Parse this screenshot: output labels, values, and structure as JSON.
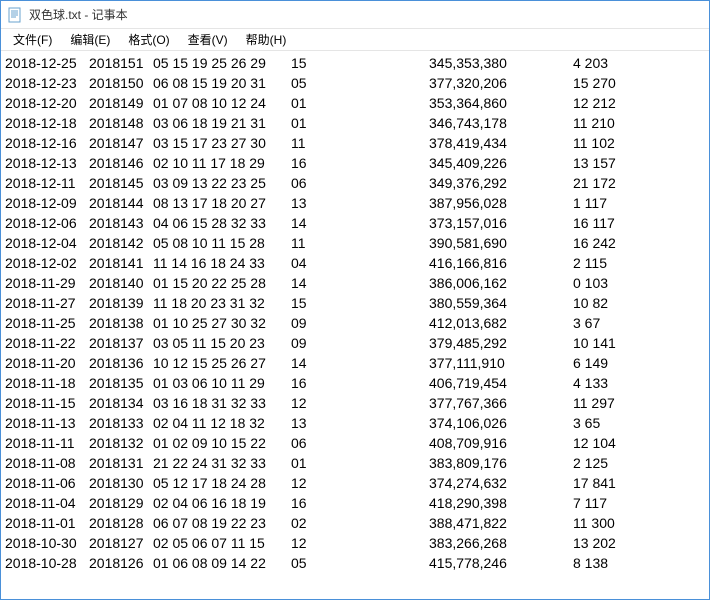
{
  "window": {
    "title": "双色球.txt - 记事本"
  },
  "menu": {
    "file": "文件(F)",
    "edit": "编辑(E)",
    "format": "格式(O)",
    "view": "查看(V)",
    "help": "帮助(H)"
  },
  "rows": [
    {
      "date": "2018-12-25",
      "issue": "2018151",
      "balls": "05 15 19 25 26 29",
      "blue": "15",
      "sales": "345,353,380",
      "prize": "4 203"
    },
    {
      "date": "2018-12-23",
      "issue": "2018150",
      "balls": "06 08 15 19 20 31",
      "blue": "05",
      "sales": "377,320,206",
      "prize": "15 270"
    },
    {
      "date": "2018-12-20",
      "issue": "2018149",
      "balls": "01 07 08 10 12 24",
      "blue": "01",
      "sales": "353,364,860",
      "prize": "12 212"
    },
    {
      "date": "2018-12-18",
      "issue": "2018148",
      "balls": "03 06 18 19 21 31",
      "blue": "01",
      "sales": "346,743,178",
      "prize": "11 210"
    },
    {
      "date": "2018-12-16",
      "issue": "2018147",
      "balls": "03 15 17 23 27 30",
      "blue": "11",
      "sales": "378,419,434",
      "prize": "11 102"
    },
    {
      "date": "2018-12-13",
      "issue": "2018146",
      "balls": "02 10 11 17 18 29",
      "blue": "16",
      "sales": "345,409,226",
      "prize": "13 157"
    },
    {
      "date": "2018-12-11",
      "issue": "2018145",
      "balls": "03 09 13 22 23 25",
      "blue": "06",
      "sales": "349,376,292",
      "prize": "21 172"
    },
    {
      "date": "2018-12-09",
      "issue": "2018144",
      "balls": "08 13 17 18 20 27",
      "blue": "13",
      "sales": "387,956,028",
      "prize": "1 117"
    },
    {
      "date": "2018-12-06",
      "issue": "2018143",
      "balls": "04 06 15 28 32 33",
      "blue": "14",
      "sales": "373,157,016",
      "prize": "16 117"
    },
    {
      "date": "2018-12-04",
      "issue": "2018142",
      "balls": "05 08 10 11 15 28",
      "blue": "11",
      "sales": "390,581,690",
      "prize": "16 242"
    },
    {
      "date": "2018-12-02",
      "issue": "2018141",
      "balls": "11 14 16 18 24 33",
      "blue": "04",
      "sales": "416,166,816",
      "prize": "2 115"
    },
    {
      "date": "2018-11-29",
      "issue": "2018140",
      "balls": "01 15 20 22 25 28",
      "blue": "14",
      "sales": "386,006,162",
      "prize": "0 103"
    },
    {
      "date": "2018-11-27",
      "issue": "2018139",
      "balls": "11 18 20 23 31 32",
      "blue": "15",
      "sales": "380,559,364",
      "prize": "10 82"
    },
    {
      "date": "2018-11-25",
      "issue": "2018138",
      "balls": "01 10 25 27 30 32",
      "blue": "09",
      "sales": "412,013,682",
      "prize": "3 67"
    },
    {
      "date": "2018-11-22",
      "issue": "2018137",
      "balls": "03 05 11 15 20 23",
      "blue": "09",
      "sales": "379,485,292",
      "prize": "10 141"
    },
    {
      "date": "2018-11-20",
      "issue": "2018136",
      "balls": "10 12 15 25 26 27",
      "blue": "14",
      "sales": "377,111,910",
      "prize": "6 149"
    },
    {
      "date": "2018-11-18",
      "issue": "2018135",
      "balls": "01 03 06 10 11 29",
      "blue": "16",
      "sales": "406,719,454",
      "prize": "4 133"
    },
    {
      "date": "2018-11-15",
      "issue": "2018134",
      "balls": "03 16 18 31 32 33",
      "blue": "12",
      "sales": "377,767,366",
      "prize": "11 297"
    },
    {
      "date": "2018-11-13",
      "issue": "2018133",
      "balls": "02 04 11 12 18 32",
      "blue": "13",
      "sales": "374,106,026",
      "prize": "3 65"
    },
    {
      "date": "2018-11-11",
      "issue": "2018132",
      "balls": "01 02 09 10 15 22",
      "blue": "06",
      "sales": "408,709,916",
      "prize": "12 104"
    },
    {
      "date": "2018-11-08",
      "issue": "2018131",
      "balls": "21 22 24 31 32 33",
      "blue": "01",
      "sales": "383,809,176",
      "prize": "2 125"
    },
    {
      "date": "2018-11-06",
      "issue": "2018130",
      "balls": "05 12 17 18 24 28",
      "blue": "12",
      "sales": "374,274,632",
      "prize": "17 841"
    },
    {
      "date": "2018-11-04",
      "issue": "2018129",
      "balls": "02 04 06 16 18 19",
      "blue": "16",
      "sales": "418,290,398",
      "prize": "7 117"
    },
    {
      "date": "2018-11-01",
      "issue": "2018128",
      "balls": "06 07 08 19 22 23",
      "blue": "02",
      "sales": "388,471,822",
      "prize": "11 300"
    },
    {
      "date": "2018-10-30",
      "issue": "2018127",
      "balls": "02 05 06 07 11 15",
      "blue": "12",
      "sales": "383,266,268",
      "prize": "13 202"
    },
    {
      "date": "2018-10-28",
      "issue": "2018126",
      "balls": "01 06 08 09 14 22",
      "blue": "05",
      "sales": "415,778,246",
      "prize": "8 138"
    }
  ]
}
